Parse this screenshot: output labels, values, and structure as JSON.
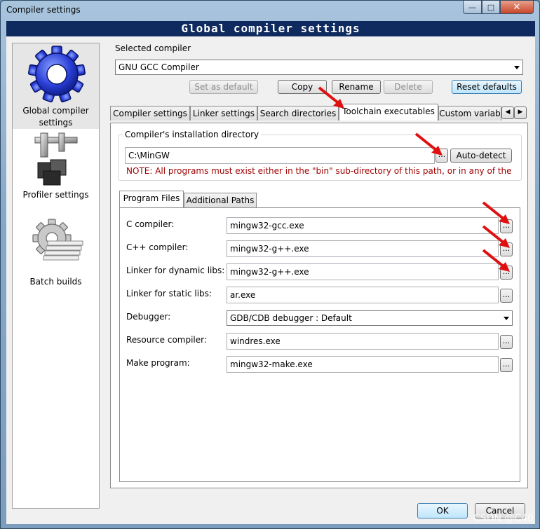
{
  "window": {
    "title": "Compiler settings"
  },
  "header": {
    "title": "Global compiler settings"
  },
  "categories": [
    {
      "label": "Global compiler settings",
      "icon": "gear-icon",
      "selected": true
    },
    {
      "label": "Profiler settings",
      "icon": "caliper-icon",
      "selected": false
    },
    {
      "label": "Batch builds",
      "icon": "batch-gear-icon",
      "selected": false
    }
  ],
  "selected_compiler": {
    "label": "Selected compiler",
    "value": "GNU GCC Compiler"
  },
  "compiler_buttons": {
    "set_default": "Set as default",
    "copy": "Copy",
    "rename": "Rename",
    "delete": "Delete",
    "reset_defaults": "Reset defaults"
  },
  "main_tabs": [
    {
      "label": "Compiler settings"
    },
    {
      "label": "Linker settings"
    },
    {
      "label": "Search directories"
    },
    {
      "label": "Toolchain executables",
      "active": true
    },
    {
      "label": "Custom variab"
    }
  ],
  "install_dir": {
    "label": "Compiler's installation directory",
    "value": "C:\\MinGW",
    "browse": "...",
    "auto_detect": "Auto-detect",
    "note": "NOTE: All programs must exist either in the \"bin\" sub-directory of this path, or in any of the"
  },
  "sub_tabs": [
    {
      "label": "Program Files",
      "active": true
    },
    {
      "label": "Additional Paths"
    }
  ],
  "programs": [
    {
      "label": "C compiler:",
      "value": "mingw32-gcc.exe"
    },
    {
      "label": "C++ compiler:",
      "value": "mingw32-g++.exe"
    },
    {
      "label": "Linker for dynamic libs:",
      "value": "mingw32-g++.exe"
    },
    {
      "label": "Linker for static libs:",
      "value": "ar.exe"
    },
    {
      "label": "Debugger:",
      "value": "GDB/CDB debugger : Default"
    },
    {
      "label": "Resource compiler:",
      "value": "windres.exe"
    },
    {
      "label": "Make program:",
      "value": "mingw32-make.exe"
    }
  ],
  "browse_label": "...",
  "footer": {
    "ok": "OK",
    "cancel": "Cancel"
  },
  "watermark": "CSDN @C40",
  "colors": {
    "header_bg": "#0e2a5e",
    "note": "#a00000",
    "arrow": "#e01010"
  }
}
